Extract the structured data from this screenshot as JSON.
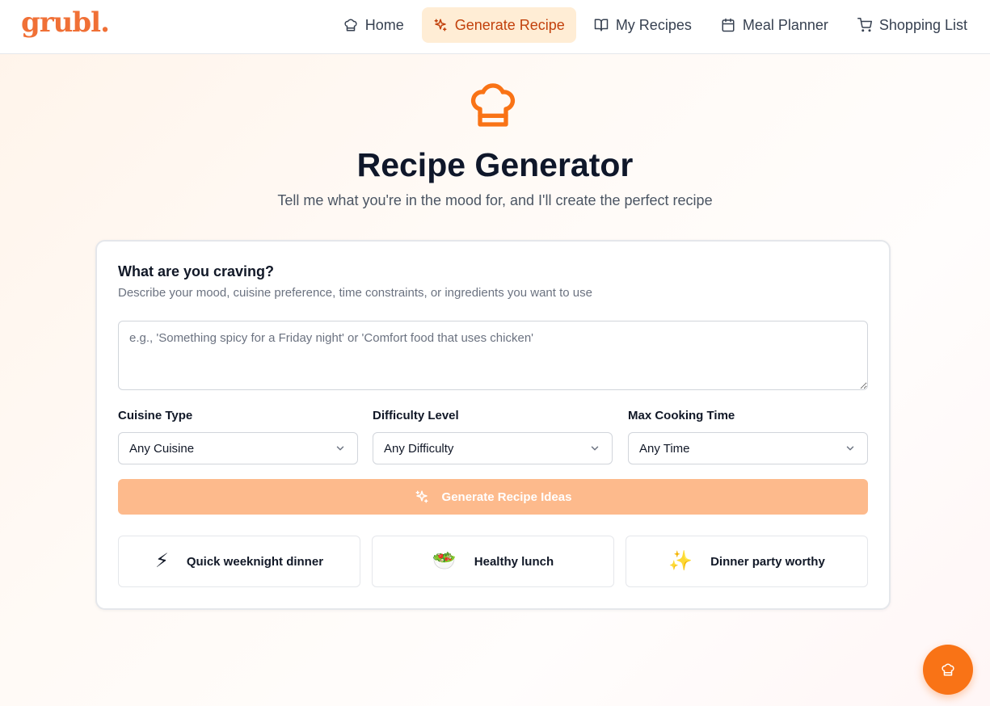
{
  "brand": {
    "logo": "grubl.",
    "accent": "#f97316"
  },
  "nav": [
    {
      "label": "Home",
      "icon": "chef-hat-icon",
      "active": false
    },
    {
      "label": "Generate Recipe",
      "icon": "sparkles-icon",
      "active": true
    },
    {
      "label": "My Recipes",
      "icon": "book-open-icon",
      "active": false
    },
    {
      "label": "Meal Planner",
      "icon": "calendar-icon",
      "active": false
    },
    {
      "label": "Shopping List",
      "icon": "shopping-cart-icon",
      "active": false
    }
  ],
  "hero": {
    "icon": "chef-hat-icon",
    "title": "Recipe Generator",
    "subtitle": "Tell me what you're in the mood for, and I'll create the perfect recipe"
  },
  "form": {
    "heading": "What are you craving?",
    "description": "Describe your mood, cuisine preference, time constraints, or ingredients you want to use",
    "craving_placeholder": "e.g., 'Something spicy for a Friday night' or 'Comfort food that uses chicken'",
    "craving_value": "",
    "cuisine": {
      "label": "Cuisine Type",
      "value": "Any Cuisine"
    },
    "difficulty": {
      "label": "Difficulty Level",
      "value": "Any Difficulty"
    },
    "time": {
      "label": "Max Cooking Time",
      "value": "Any Time"
    },
    "generate_label": "Generate Recipe Ideas"
  },
  "presets": [
    {
      "emoji": "⚡",
      "label": "Quick weeknight dinner"
    },
    {
      "emoji": "🥗",
      "label": "Healthy lunch"
    },
    {
      "emoji": "✨",
      "label": "Dinner party worthy"
    }
  ],
  "fab": {
    "icon": "chef-hat-icon"
  }
}
